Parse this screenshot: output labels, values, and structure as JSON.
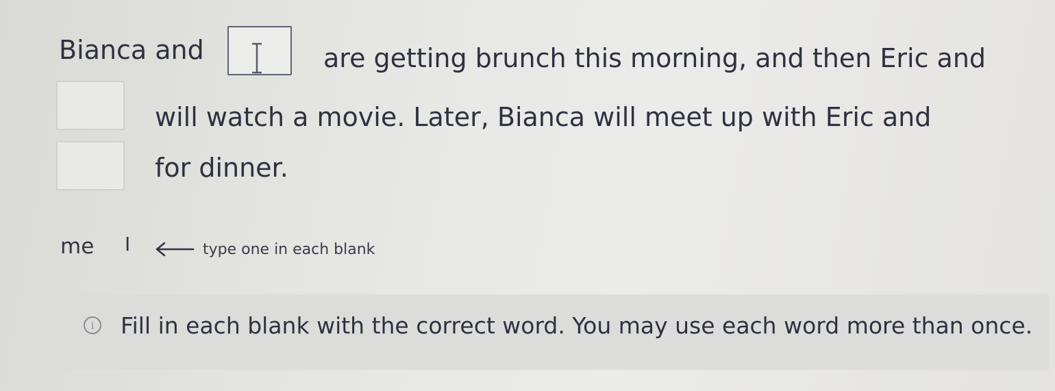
{
  "passage": {
    "line1_part1": "Bianca and",
    "line1_part2": "are getting brunch this morning, and then Eric and",
    "line2": "will watch a movie. Later, Bianca will meet up with Eric and",
    "line3": "for dinner."
  },
  "blanks": [
    {
      "value": "",
      "state": "focused"
    },
    {
      "value": "",
      "state": "empty"
    },
    {
      "value": "",
      "state": "empty"
    }
  ],
  "word_bank": {
    "words": [
      "me",
      "I"
    ],
    "hint": "type one in each blank"
  },
  "info": {
    "icon": "info-icon",
    "glyph": "i",
    "text": "Fill in each blank with the correct word. You may use each word more than once."
  },
  "colors": {
    "text": "#2f3140",
    "blank_border": "#cfd0d2",
    "info_background": "#dcdddb"
  }
}
